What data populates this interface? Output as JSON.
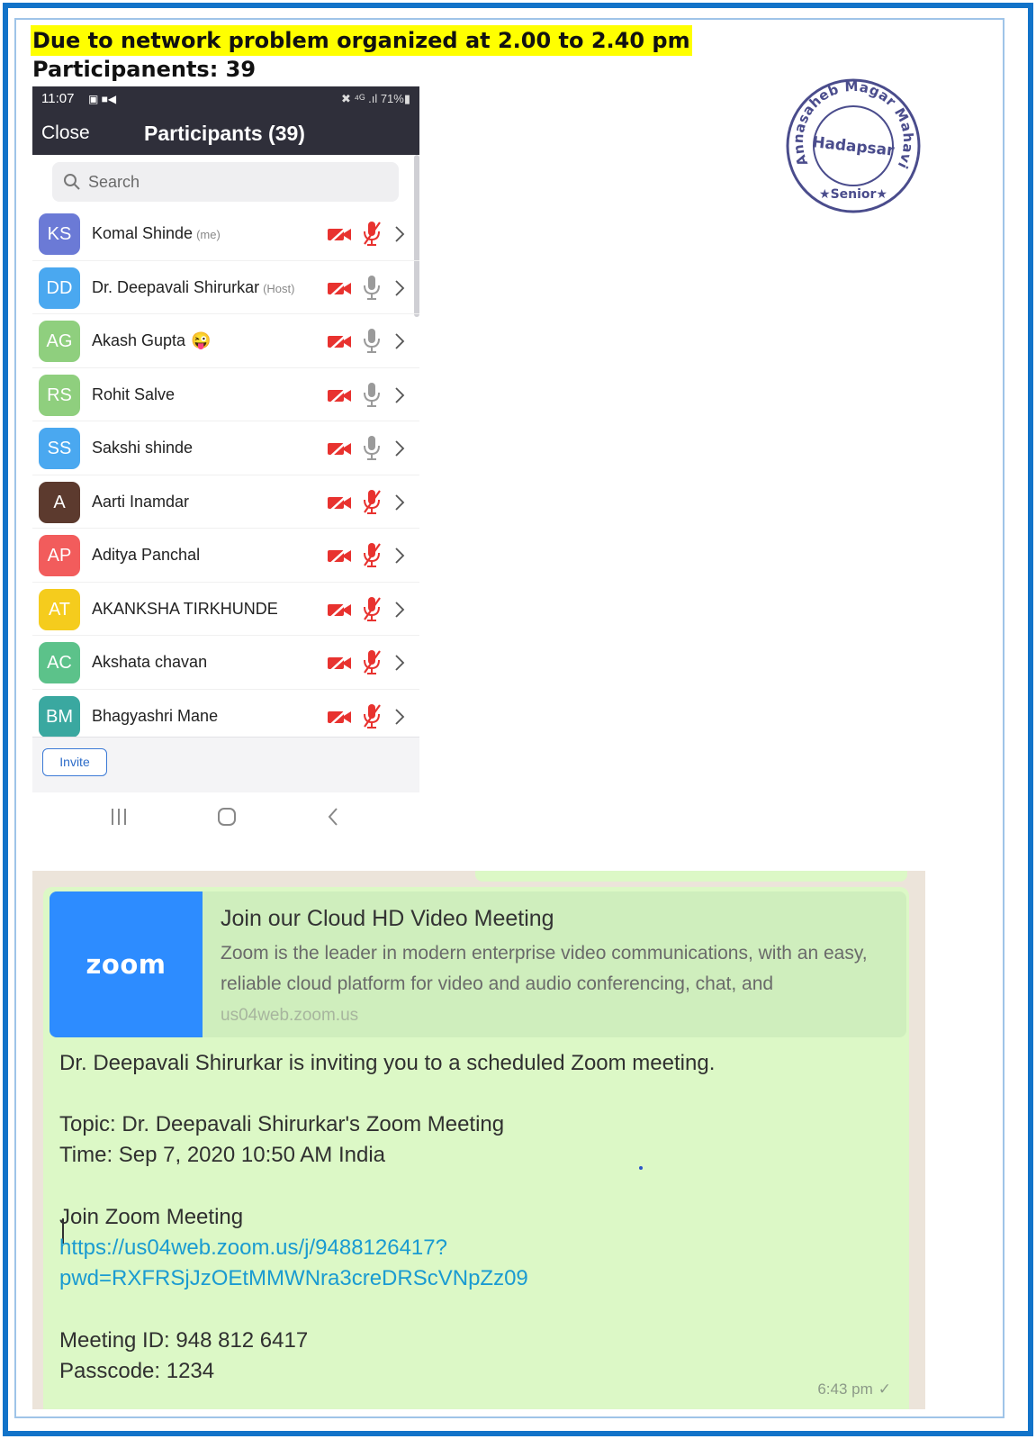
{
  "headline": "Due to network problem organized at 2.00 to 2.40 pm",
  "subline": "Participanents: 39",
  "phone": {
    "status_time": "11:07",
    "status_left_icons": "▣ ■◀",
    "status_right": "✖ ⁴ᴳ .ıl 71%▮",
    "close_label": "Close",
    "title": "Participants (39)",
    "search_placeholder": "Search",
    "invite_label": "Invite",
    "participants": [
      {
        "initials": "KS",
        "name": "Komal Shinde",
        "tag": "(me)",
        "color": "#6b7ad6",
        "mic": "muted"
      },
      {
        "initials": "DD",
        "name": "Dr. Deepavali Shirurkar",
        "tag": "(Host)",
        "color": "#4aa8f0",
        "mic": "on"
      },
      {
        "initials": "AG",
        "name": "Akash Gupta",
        "tag": "",
        "emoji": "😜",
        "color": "#8fcf7e",
        "mic": "on"
      },
      {
        "initials": "RS",
        "name": "Rohit Salve",
        "tag": "",
        "color": "#8fcf7e",
        "mic": "on"
      },
      {
        "initials": "SS",
        "name": "Sakshi shinde",
        "tag": "",
        "color": "#4aa8f0",
        "mic": "on"
      },
      {
        "initials": "A",
        "name": "Aarti Inamdar",
        "tag": "",
        "color": "#5c3a2e",
        "mic": "muted"
      },
      {
        "initials": "AP",
        "name": "Aditya Panchal",
        "tag": "",
        "color": "#f25c5c",
        "mic": "muted"
      },
      {
        "initials": "AT",
        "name": "AKANKSHA TIRKHUNDE",
        "tag": "",
        "color": "#f5cc1d",
        "mic": "muted"
      },
      {
        "initials": "AC",
        "name": "Akshata chavan",
        "tag": "",
        "color": "#5cc28a",
        "mic": "muted"
      },
      {
        "initials": "BM",
        "name": "Bhagyashri Mane",
        "tag": "",
        "color": "#3aa8a0",
        "mic": "muted"
      }
    ]
  },
  "seal": {
    "outer_text": "Annasaheb Magar Mahavidyalaya",
    "center_text": "Hadapsar",
    "bottom_text": "★Senior★"
  },
  "whatsapp": {
    "preview_logo": "zoom",
    "preview_title": "Join our Cloud HD Video Meeting",
    "preview_desc": "Zoom is the leader in modern enterprise video communications, with an easy, reliable cloud platform for video and audio conferencing, chat, and",
    "preview_url": "us04web.zoom.us",
    "line_invite": "Dr. Deepavali Shirurkar is inviting you to a scheduled Zoom meeting.",
    "line_topic": "Topic: Dr. Deepavali Shirurkar's Zoom Meeting",
    "line_time": "Time: Sep 7, 2020 10:50 AM India",
    "line_join": "Join Zoom Meeting",
    "link_1": "https://us04web.zoom.us/j/9488126417?",
    "link_2": "pwd=RXFRSjJzOEtMMWNra3creDRScVNpZz09",
    "line_meeting_id": "Meeting ID: 948 812 6417",
    "line_passcode": "Passcode: 1234",
    "timestamp": "6:43 pm",
    "tick": "✓"
  }
}
